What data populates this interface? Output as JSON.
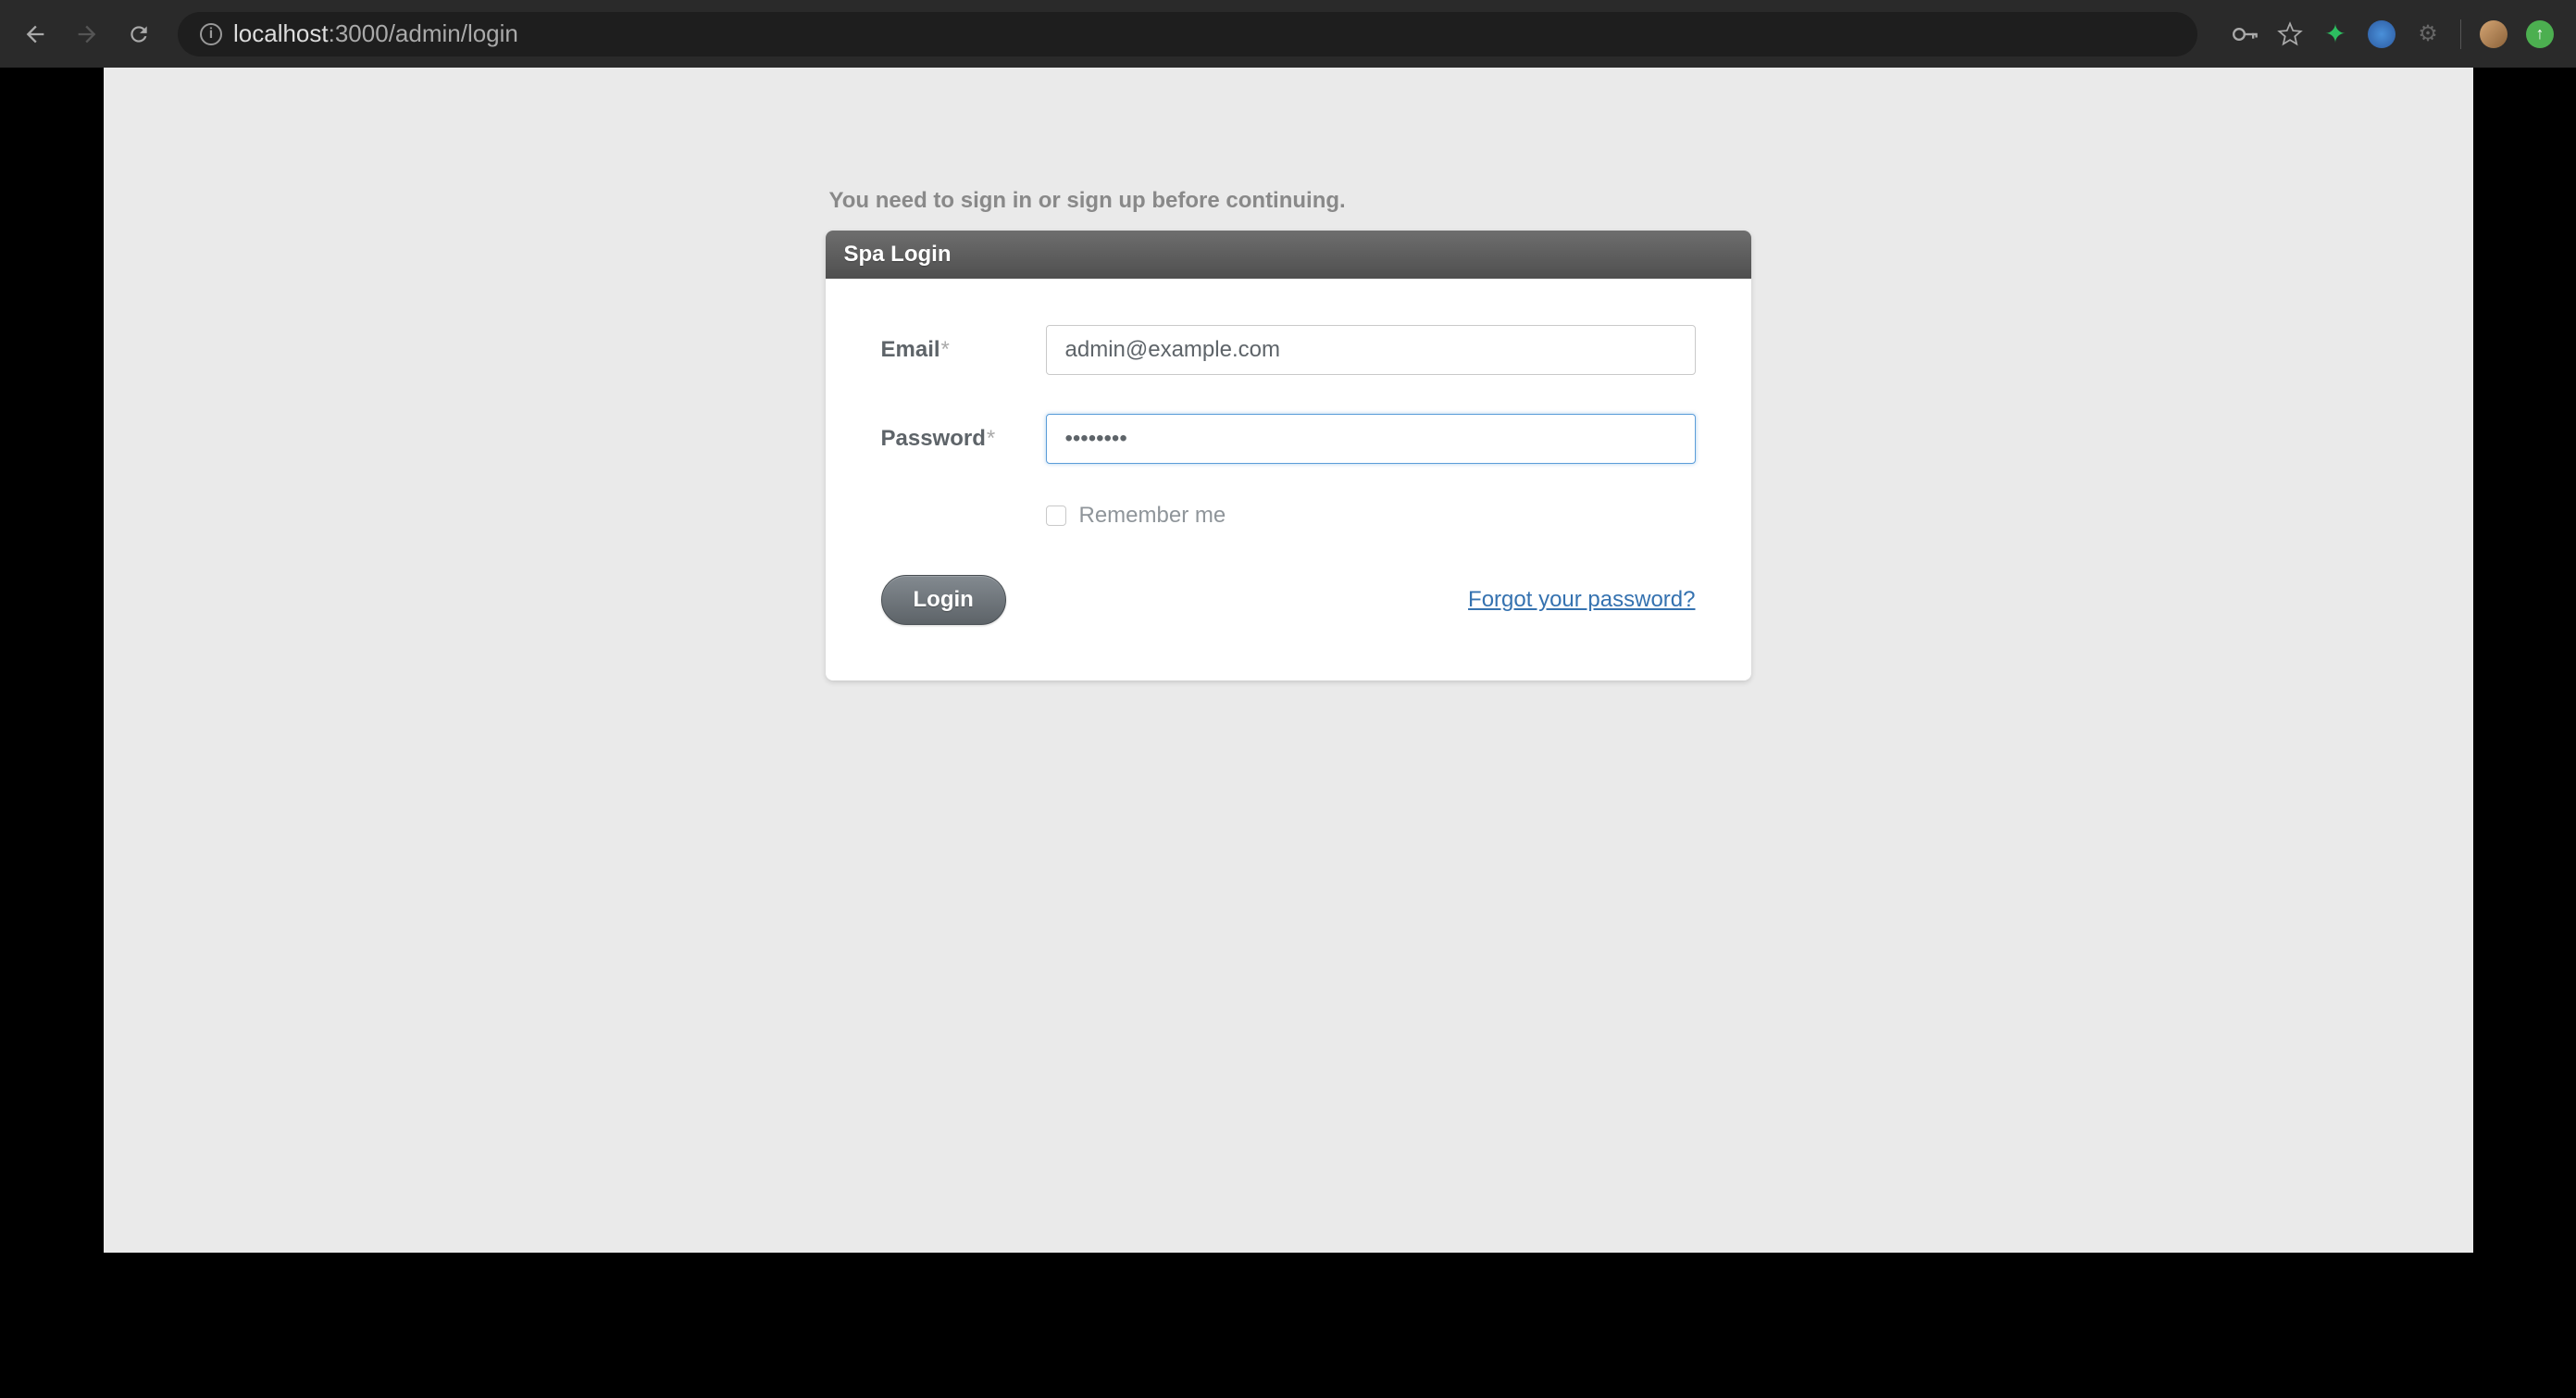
{
  "browser": {
    "url_host": "localhost",
    "url_path": ":3000/admin/login"
  },
  "flash": {
    "message": "You need to sign in or sign up before continuing."
  },
  "panel": {
    "title": "Spa Login"
  },
  "form": {
    "email_label": "Email",
    "email_value": "admin@example.com",
    "password_label": "Password",
    "password_value": "password",
    "remember_label": "Remember me",
    "remember_checked": false,
    "submit_label": "Login",
    "forgot_label": "Forgot your password?",
    "required_mark": "*"
  }
}
